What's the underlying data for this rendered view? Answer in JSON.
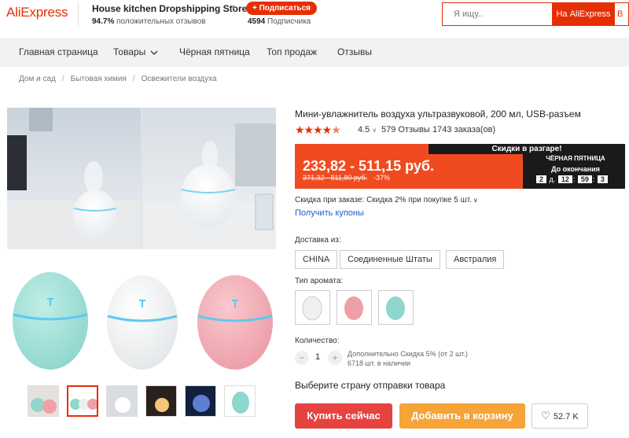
{
  "header": {
    "logo": "AliExpress",
    "store_name": "House kitchen Dropshipping Store",
    "positive_pct": "94.7%",
    "positive_label": "положительных отзывов",
    "subscribe_label": "+ Подписаться",
    "subscribers_count": "4594",
    "subscribers_label": "Подписчика",
    "search_placeholder": "Я ищу..",
    "search_button": "На AliExpress",
    "search_button2": "В"
  },
  "nav": {
    "items": [
      "Главная страница",
      "Товары",
      "Чёрная пятница",
      "Топ продаж",
      "Отзывы"
    ]
  },
  "breadcrumbs": [
    "Дом и сад",
    "Бытовая химия",
    "Освежители воздуха"
  ],
  "product": {
    "title": "Мини-увлажнитель воздуха ультразвуковой, 200 мл, USB-разъем",
    "rating": "4.5",
    "reviews": "579 Отзывы",
    "orders": "1743 заказа(ов)",
    "banner_slogan": "Скидки в разгаре!",
    "price": "233,82 - 511,15 руб.",
    "old_price": "371,32 - 811,80 руб.",
    "discount": "-37%",
    "bf_label": "ЧЁРНАЯ ПЯТНИЦА",
    "bf_until": "До окончания",
    "timer_days": "2",
    "timer_d": "д.",
    "timer_hours": "12",
    "timer_minutes": "59",
    "timer_seconds": "3",
    "order_discount": "Скидка при заказе: Скидка 2% при покупке 5 шт.",
    "coupons_link": "Получить купоны",
    "delivery_label": "Доставка из:",
    "delivery_options": [
      "CHINA",
      "Соединенные Штаты",
      "Австралия"
    ],
    "aroma_label": "Тип аромата:",
    "quantity_label": "Количество:",
    "quantity_value": "1",
    "quantity_minus": "−",
    "quantity_plus": "+",
    "extra_discount": "Дополнительно Скидка 5% (от 2 шт.)",
    "stock": "6718 шт. в наличии",
    "ship_country": "Выберите страну отправки товара",
    "buy_now": "Купить сейчас",
    "add_to_cart": "Добавить в корзину",
    "wishlist_count": "52.7 K"
  },
  "colors": {
    "accent": "#e62e04",
    "buy_button": "#e64340",
    "cart_button": "#f6a337",
    "price_banner": "#f04b20",
    "link": "#1a5fcc"
  }
}
